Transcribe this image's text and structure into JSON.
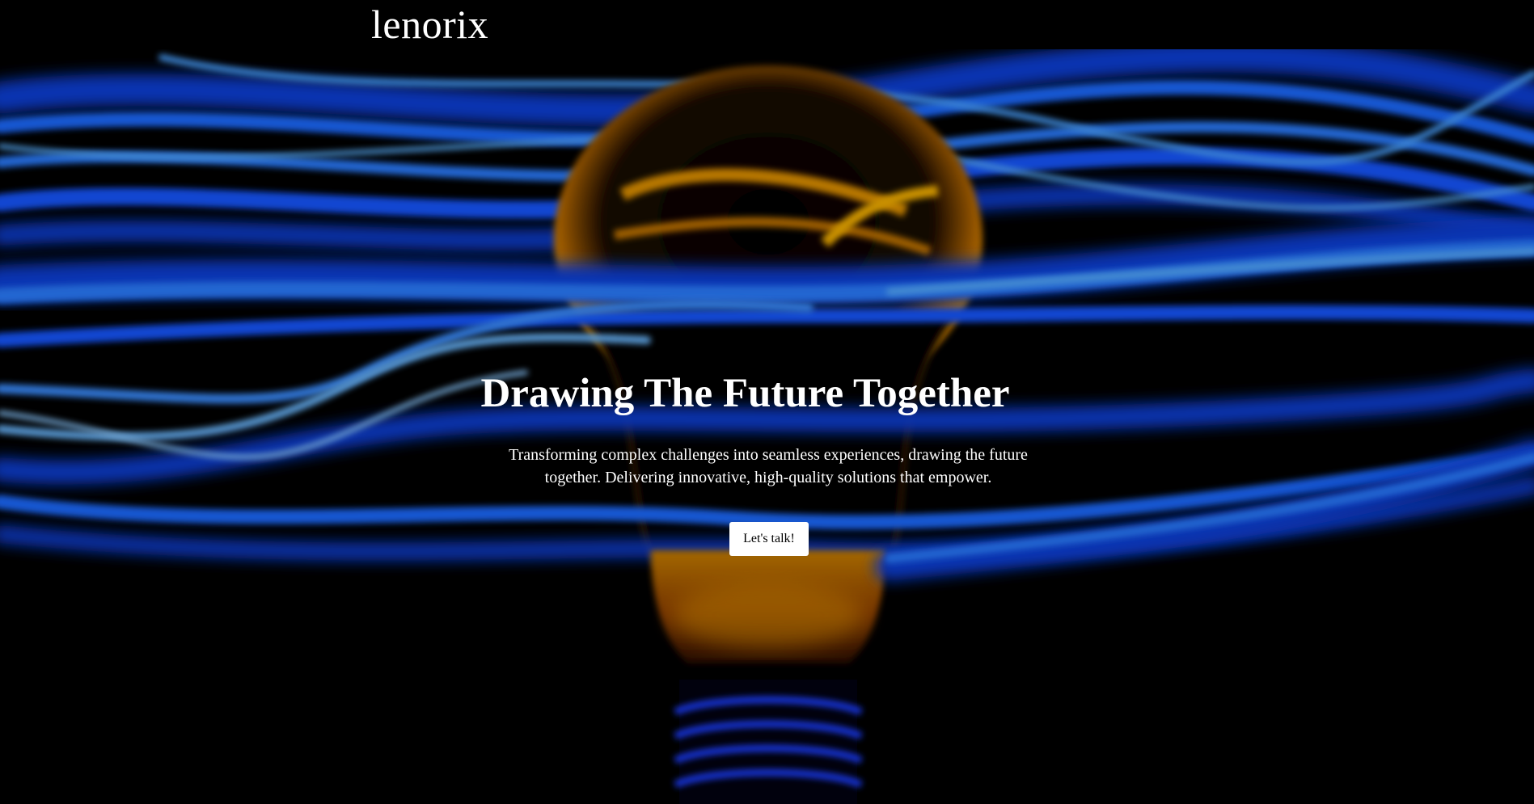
{
  "brand": {
    "logo_text": "lenorix"
  },
  "hero": {
    "headline": "Drawing The Future Together",
    "subtext": "Transforming complex challenges into seamless experiences, drawing the future together. Delivering innovative, high-quality solutions that empower.",
    "cta_label": "Let's talk!",
    "background_image": "lightbulb-with-blue-light-trails",
    "colors": {
      "background": "#000000",
      "light_trail": "#1E6BFF",
      "bulb_glow": "#F5A300",
      "text": "#FFFFFF",
      "button_bg": "#FFFFFF",
      "button_text": "#000000"
    }
  }
}
